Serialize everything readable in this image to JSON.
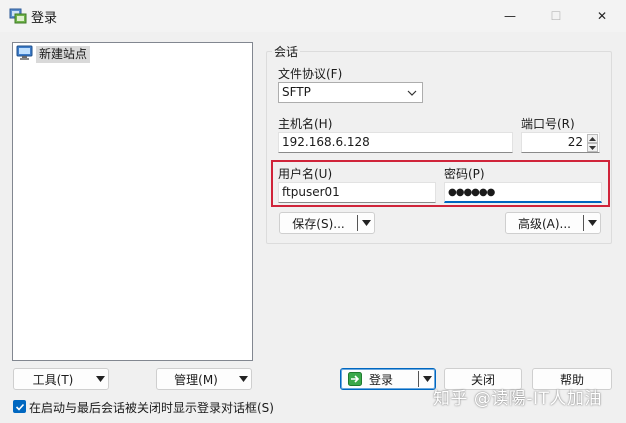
{
  "window": {
    "title": "登录",
    "minimize_glyph": "—",
    "maximize_glyph": "☐",
    "close_glyph": "✕"
  },
  "site_tree": {
    "items": [
      {
        "label": "新建站点",
        "icon": "monitor-icon"
      }
    ]
  },
  "session": {
    "group_title": "会话",
    "protocol_label": "文件协议(F)",
    "protocol_value": "SFTP",
    "host_label": "主机名(H)",
    "host_value": "192.168.6.128",
    "port_label": "端口号(R)",
    "port_value": "22",
    "user_label": "用户名(U)",
    "user_value": "ftpuser01",
    "password_label": "密码(P)",
    "password_value": "●●●●●●",
    "save_label": "保存(S)...",
    "advanced_label": "高级(A)..."
  },
  "footer": {
    "tools_label": "工具(T)",
    "manage_label": "管理(M)",
    "login_label": "登录",
    "close_label": "关闭",
    "help_label": "帮助",
    "checkbox_label": "在启动与最后会话被关闭时显示登录对话框(S)",
    "checkbox_checked": true
  },
  "watermark": "知乎 @读陽-IT人加油",
  "colors": {
    "accent": "#0067c0",
    "highlight_frame": "#d0243a",
    "background": "#f0f0f0"
  }
}
